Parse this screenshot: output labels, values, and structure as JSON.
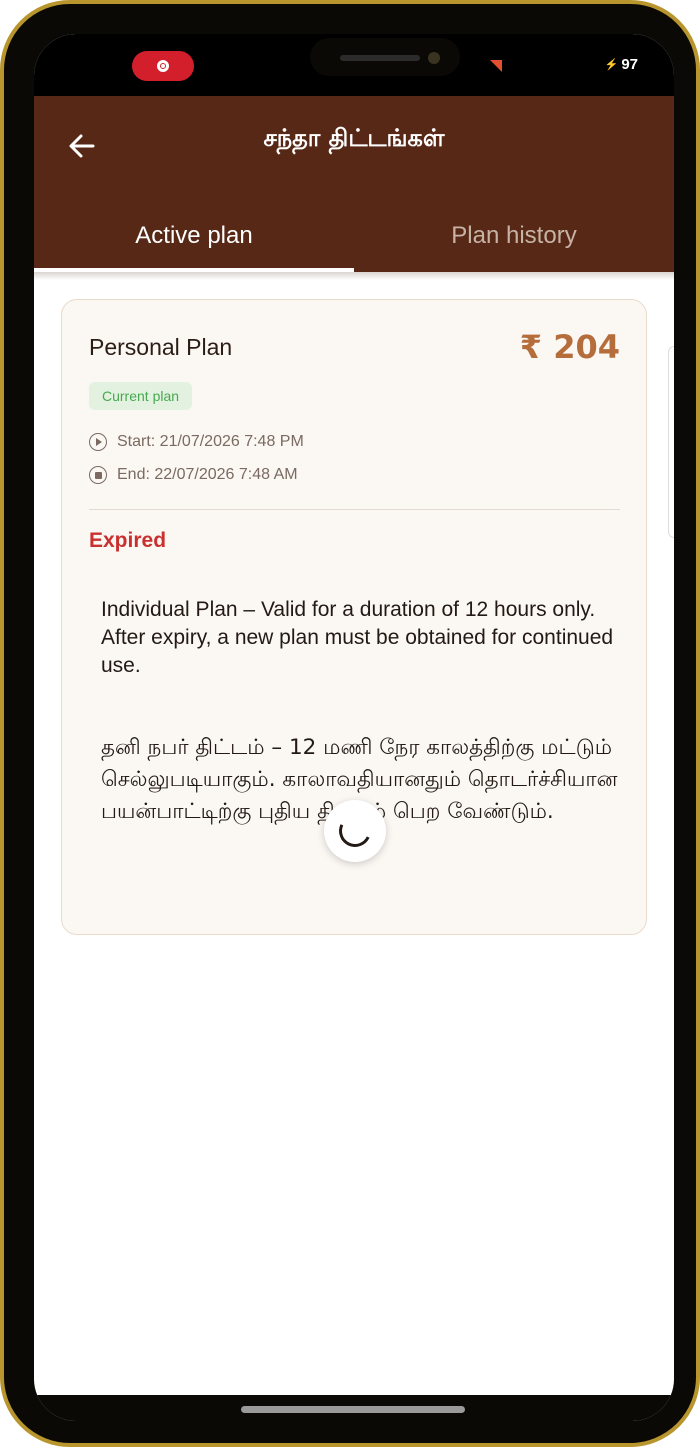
{
  "status_bar": {
    "battery_level": "97",
    "record_indicator_color": "#d21f2b"
  },
  "header": {
    "title": "சந்தா திட்டங்கள்",
    "back_icon": "arrow-left-icon",
    "background_color": "#572816"
  },
  "tabs": [
    {
      "label": "Active plan",
      "active": true
    },
    {
      "label": "Plan history",
      "active": false
    }
  ],
  "plan_card": {
    "plan_name": "Personal Plan",
    "price": "₹ 204",
    "badge": "Current plan",
    "start": "Start: 21/07/2026 7:48 PM",
    "end": "End: 22/07/2026 7:48 AM",
    "status": "Expired",
    "description_en": "Individual Plan – Valid for a duration of 12 hours only. After expiry, a new plan must be obtained for continued use.",
    "description_ta": "தனி நபர் திட்டம் – 12 மணி நேர காலத்திற்கு மட்டும் செல்லுபடியாகும். காலாவதியானதும் தொடர்ச்சியான பயன்பாட்டிற்கு புதிய திட்டம் பெற வேண்டும்.",
    "colors": {
      "price": "#b46d3b",
      "status_expired": "#c9302f",
      "badge_text": "#47a94f",
      "badge_bg": "#e3f2e0"
    }
  },
  "loading": {
    "icon": "spinner-icon"
  }
}
